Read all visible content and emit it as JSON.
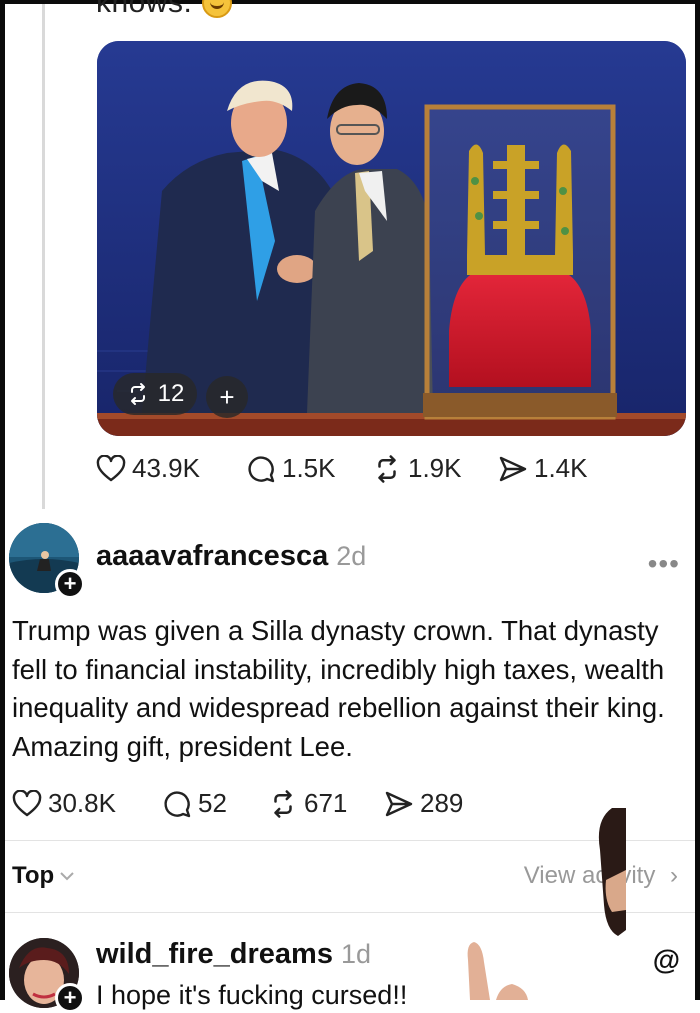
{
  "previous_post": {
    "text_fragment": "knows.",
    "emoji": "grinning-sweat-emoji",
    "image_overlay": {
      "repost_count": "12",
      "plus": "+"
    },
    "stats": {
      "likes": "43.9K",
      "replies": "1.5K",
      "reposts": "1.9K",
      "shares": "1.4K"
    }
  },
  "main_post": {
    "username": "aaaavafrancesca",
    "time": "2d",
    "more": "•••",
    "text": "Trump was given a Silla dynasty crown. That dynasty fell to financial instability, incredibly high taxes, wealth inequality and widespread rebellion against their king. Amazing gift, president Lee.",
    "stats": {
      "likes": "30.8K",
      "replies": "52",
      "reposts": "671",
      "shares": "289"
    }
  },
  "replies_header": {
    "sort_label": "Top",
    "view_activity": "View activity"
  },
  "reply": {
    "username": "wild_fire_dreams",
    "time": "1d",
    "text": "I hope it's fucking cursed!!"
  },
  "colors": {
    "accent": "#111111",
    "muted": "#999999",
    "image_bg": "#1e2f7f",
    "crown_cloth": "#d61a2c",
    "crown_gold": "#c9a227"
  },
  "icons": [
    "heart-icon",
    "comment-icon",
    "repost-icon",
    "share-icon",
    "threads-logo-icon",
    "chevron-down-icon",
    "chevron-right-icon"
  ]
}
